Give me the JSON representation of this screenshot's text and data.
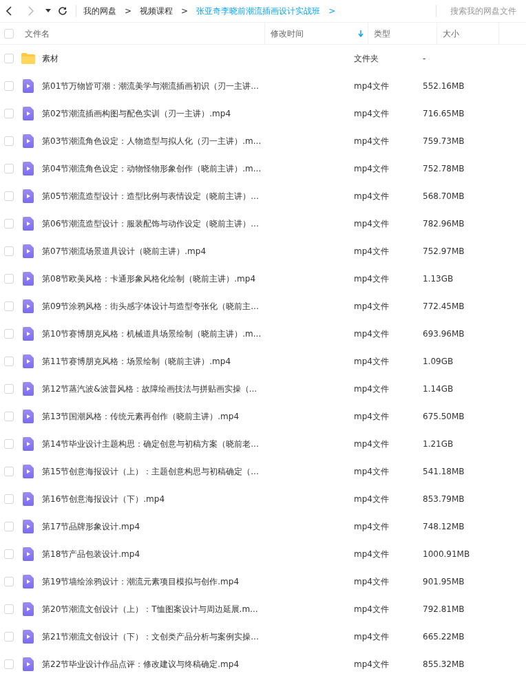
{
  "breadcrumb": [
    {
      "label": "我的网盘",
      "current": false
    },
    {
      "label": "视频课程",
      "current": false
    },
    {
      "label": "张亚奇李晓前潮流插画设计实战班",
      "current": true
    }
  ],
  "separator": ">",
  "search": {
    "placeholder": "搜索我的网盘文件"
  },
  "select_all": {
    "checked": false
  },
  "columns": [
    {
      "label": "文件名",
      "sorted": false
    },
    {
      "label": "修改时间",
      "sorted": true
    },
    {
      "label": "类型",
      "sorted": false
    },
    {
      "label": "大小",
      "sorted": false
    }
  ],
  "files": [
    {
      "kind": "folder",
      "name": "素材",
      "type": "文件夹",
      "size": "-",
      "checked": false
    },
    {
      "kind": "video",
      "name": "第01节万物皆可潮：潮流美学与潮流插画初识（刃一主讲...",
      "type": "mp4文件",
      "size": "552.16MB",
      "checked": false
    },
    {
      "kind": "video",
      "name": "第02节潮流插画构图与配色实训（刃一主讲）.mp4",
      "type": "mp4文件",
      "size": "716.65MB",
      "checked": false
    },
    {
      "kind": "video",
      "name": "第03节潮流角色设定：人物造型与拟人化（刃一主讲）.m...",
      "type": "mp4文件",
      "size": "759.73MB",
      "checked": false
    },
    {
      "kind": "video",
      "name": "第04节潮流角色设定：动物怪物形象创作（晓前主讲）.m...",
      "type": "mp4文件",
      "size": "752.78MB",
      "checked": false
    },
    {
      "kind": "video",
      "name": "第05节潮流造型设计：造型比例与表情设定（晓前主讲）...",
      "type": "mp4文件",
      "size": "568.70MB",
      "checked": false
    },
    {
      "kind": "video",
      "name": "第06节潮流造型设计：服装配饰与动作设定（晓前主讲）...",
      "type": "mp4文件",
      "size": "782.96MB",
      "checked": false
    },
    {
      "kind": "video",
      "name": "第07节潮流场景道具设计（晓前主讲）.mp4",
      "type": "mp4文件",
      "size": "752.97MB",
      "checked": false
    },
    {
      "kind": "video",
      "name": "第08节欧美风格：卡通形象风格化绘制（晓前主讲）.mp4",
      "type": "mp4文件",
      "size": "1.13GB",
      "checked": false
    },
    {
      "kind": "video",
      "name": "第09节涂鸦风格：街头感字体设计与造型夸张化（晓前主...",
      "type": "mp4文件",
      "size": "772.45MB",
      "checked": false
    },
    {
      "kind": "video",
      "name": "第10节赛博朋克风格：机械道具场景绘制（晓前主讲）.m...",
      "type": "mp4文件",
      "size": "693.96MB",
      "checked": false
    },
    {
      "kind": "video",
      "name": "第11节赛博朋克风格：场景绘制（晓前主讲）.mp4",
      "type": "mp4文件",
      "size": "1.09GB",
      "checked": false
    },
    {
      "kind": "video",
      "name": "第12节蒸汽波&波普风格：故障绘画技法与拼贴画实操（...",
      "type": "mp4文件",
      "size": "1.14GB",
      "checked": false
    },
    {
      "kind": "video",
      "name": "第13节国潮风格：传统元素再创作（晓前主讲）.mp4",
      "type": "mp4文件",
      "size": "675.50MB",
      "checked": false
    },
    {
      "kind": "video",
      "name": "第14节毕业设计主题构思：确定创意与初稿方案（晓前老...",
      "type": "mp4文件",
      "size": "1.21GB",
      "checked": false
    },
    {
      "kind": "video",
      "name": "第15节创意海报设计（上）：主题创意构思与初稿确定（...",
      "type": "mp4文件",
      "size": "541.18MB",
      "checked": false
    },
    {
      "kind": "video",
      "name": "第16节创意海报设计（下）.mp4",
      "type": "mp4文件",
      "size": "853.79MB",
      "checked": false
    },
    {
      "kind": "video",
      "name": "第17节品牌形象设计.mp4",
      "type": "mp4文件",
      "size": "748.12MB",
      "checked": false
    },
    {
      "kind": "video",
      "name": "第18节产品包装设计.mp4",
      "type": "mp4文件",
      "size": "1000.91MB",
      "checked": false
    },
    {
      "kind": "video",
      "name": "第19节墙绘涂鸦设计：潮流元素项目模拟与创作.mp4",
      "type": "mp4文件",
      "size": "901.95MB",
      "checked": false
    },
    {
      "kind": "video",
      "name": "第20节潮流文创设计（上）：T恤图案设计与周边延展.m...",
      "type": "mp4文件",
      "size": "792.81MB",
      "checked": false
    },
    {
      "kind": "video",
      "name": "第21节潮流文创设计（下）：文创类产品分析与案例实操...",
      "type": "mp4文件",
      "size": "665.22MB",
      "checked": false
    },
    {
      "kind": "video",
      "name": "第22节毕业设计作品点评：修改建议与终稿确定.mp4",
      "type": "mp4文件",
      "size": "855.32MB",
      "checked": false
    }
  ]
}
